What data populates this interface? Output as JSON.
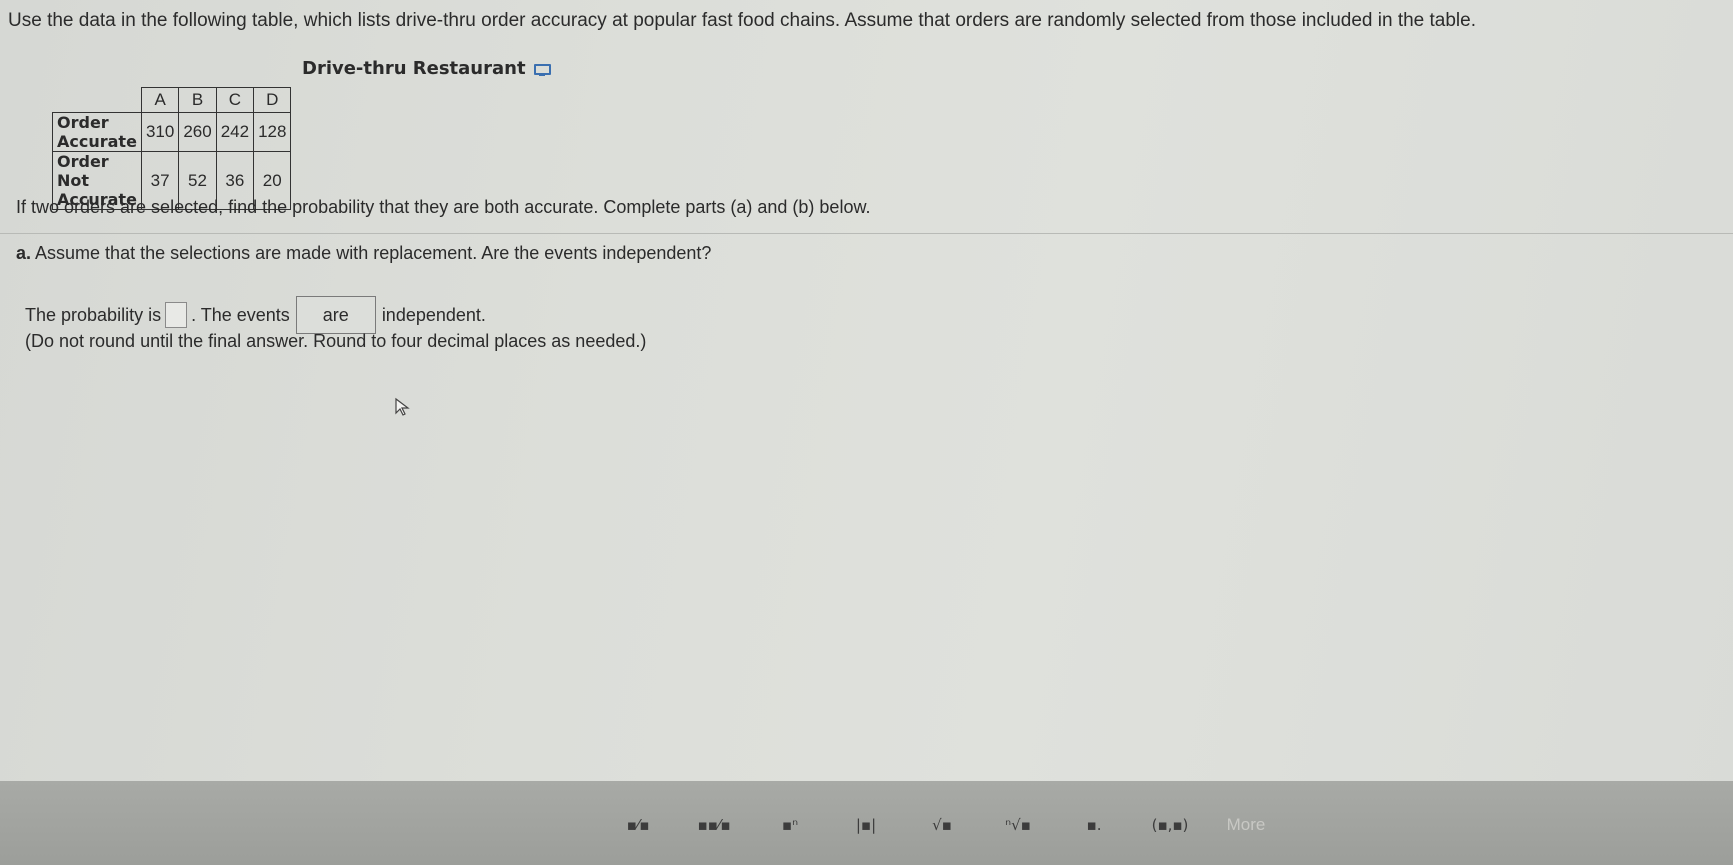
{
  "intro": "Use the data in the following table, which lists drive-thru order accuracy at popular fast food chains. Assume that orders are randomly selected from those included in the table.",
  "table": {
    "caption": "Drive-thru Restaurant",
    "columns": [
      "A",
      "B",
      "C",
      "D"
    ],
    "rows": [
      {
        "label": "Order Accurate",
        "values": [
          "310",
          "260",
          "242",
          "128"
        ]
      },
      {
        "label": "Order Not Accurate",
        "values": [
          "37",
          "52",
          "36",
          "20"
        ]
      }
    ]
  },
  "question": "If two orders are selected, find the probability that they are both accurate. Complete parts (a) and (b) below.",
  "part_a": {
    "letter": "a.",
    "text": "Assume that the selections are made with replacement. Are the events independent?"
  },
  "answer": {
    "prefix": "The probability is",
    "probability_value": "",
    "middle": ". The events",
    "dropdown_value": "are",
    "suffix": "independent."
  },
  "note": "(Do not round until the final answer. Round to four decimal places as needed.)",
  "toolbar": {
    "buttons": [
      {
        "icon": "fraction-icon",
        "glyph": "▪⁄▪"
      },
      {
        "icon": "mixed-number-icon",
        "glyph": "▪▪⁄▪"
      },
      {
        "icon": "exponent-icon",
        "glyph": "▪ⁿ"
      },
      {
        "icon": "absolute-value-icon",
        "glyph": "|▪|"
      },
      {
        "icon": "square-root-icon",
        "glyph": "√▪"
      },
      {
        "icon": "nth-root-icon",
        "glyph": "ⁿ√▪"
      },
      {
        "icon": "subscript-icon",
        "glyph": "▪."
      },
      {
        "icon": "ordered-pair-icon",
        "glyph": "(▪,▪)"
      }
    ],
    "more_label": "More"
  }
}
